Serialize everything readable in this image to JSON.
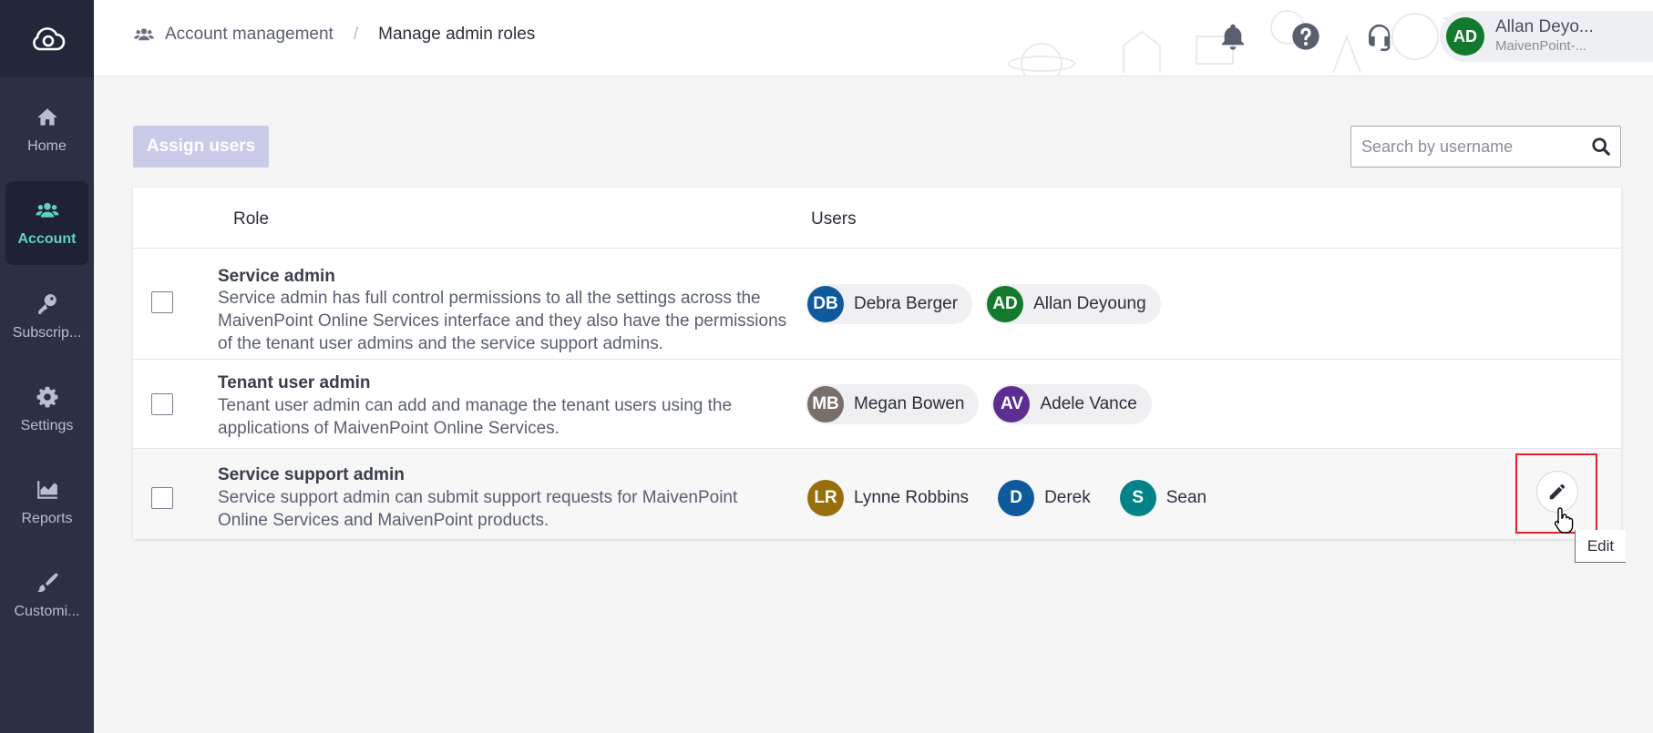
{
  "sidebar": {
    "items": [
      {
        "label": "Home",
        "icon": "home-icon"
      },
      {
        "label": "Account",
        "icon": "people-icon",
        "active": true
      },
      {
        "label": "Subscrip...",
        "icon": "key-icon"
      },
      {
        "label": "Settings",
        "icon": "gear-icon"
      },
      {
        "label": "Reports",
        "icon": "chart-icon"
      },
      {
        "label": "Customi...",
        "icon": "brush-icon"
      }
    ]
  },
  "header": {
    "breadcrumb": {
      "parent": "Account management",
      "separator": "/",
      "current": "Manage admin roles"
    },
    "user": {
      "initials": "AD",
      "name": "Allan Deyo...",
      "org": "MaivenPoint-..."
    }
  },
  "toolbar": {
    "assign_label": "Assign users",
    "search_placeholder": "Search by username"
  },
  "table": {
    "headers": {
      "role": "Role",
      "users": "Users"
    },
    "rows": [
      {
        "title": "Service admin",
        "description": "Service admin has full control permissions to all the settings across the MaivenPoint Online Services interface and they also have the permissions of the tenant user admins and the service support admins.",
        "users": [
          {
            "initials": "DB",
            "name": "Debra Berger",
            "color": "#0f5a9c"
          },
          {
            "initials": "AD",
            "name": "Allan Deyoung",
            "color": "#137a2d"
          }
        ]
      },
      {
        "title": "Tenant user admin",
        "description": "Tenant user admin can add and manage the tenant users using the applications of MaivenPoint Online Services.",
        "users": [
          {
            "initials": "MB",
            "name": "Megan Bowen",
            "color": "#7a6e6a"
          },
          {
            "initials": "AV",
            "name": "Adele Vance",
            "color": "#5c2e91"
          }
        ]
      },
      {
        "title": "Service support admin",
        "description": "Service support admin can submit support requests for MaivenPoint Online Services and MaivenPoint products.",
        "users": [
          {
            "initials": "LR",
            "name": "Lynne Robbins",
            "color": "#986f0b"
          },
          {
            "initials": "D",
            "name": "Derek",
            "color": "#0f5a9c"
          },
          {
            "initials": "S",
            "name": "Sean",
            "color": "#038387"
          }
        ]
      }
    ]
  },
  "tooltip": {
    "edit": "Edit"
  },
  "colors": {
    "sidebar": "#2b3045",
    "accent": "#5fd1c2",
    "highlight": "#e0202a"
  }
}
